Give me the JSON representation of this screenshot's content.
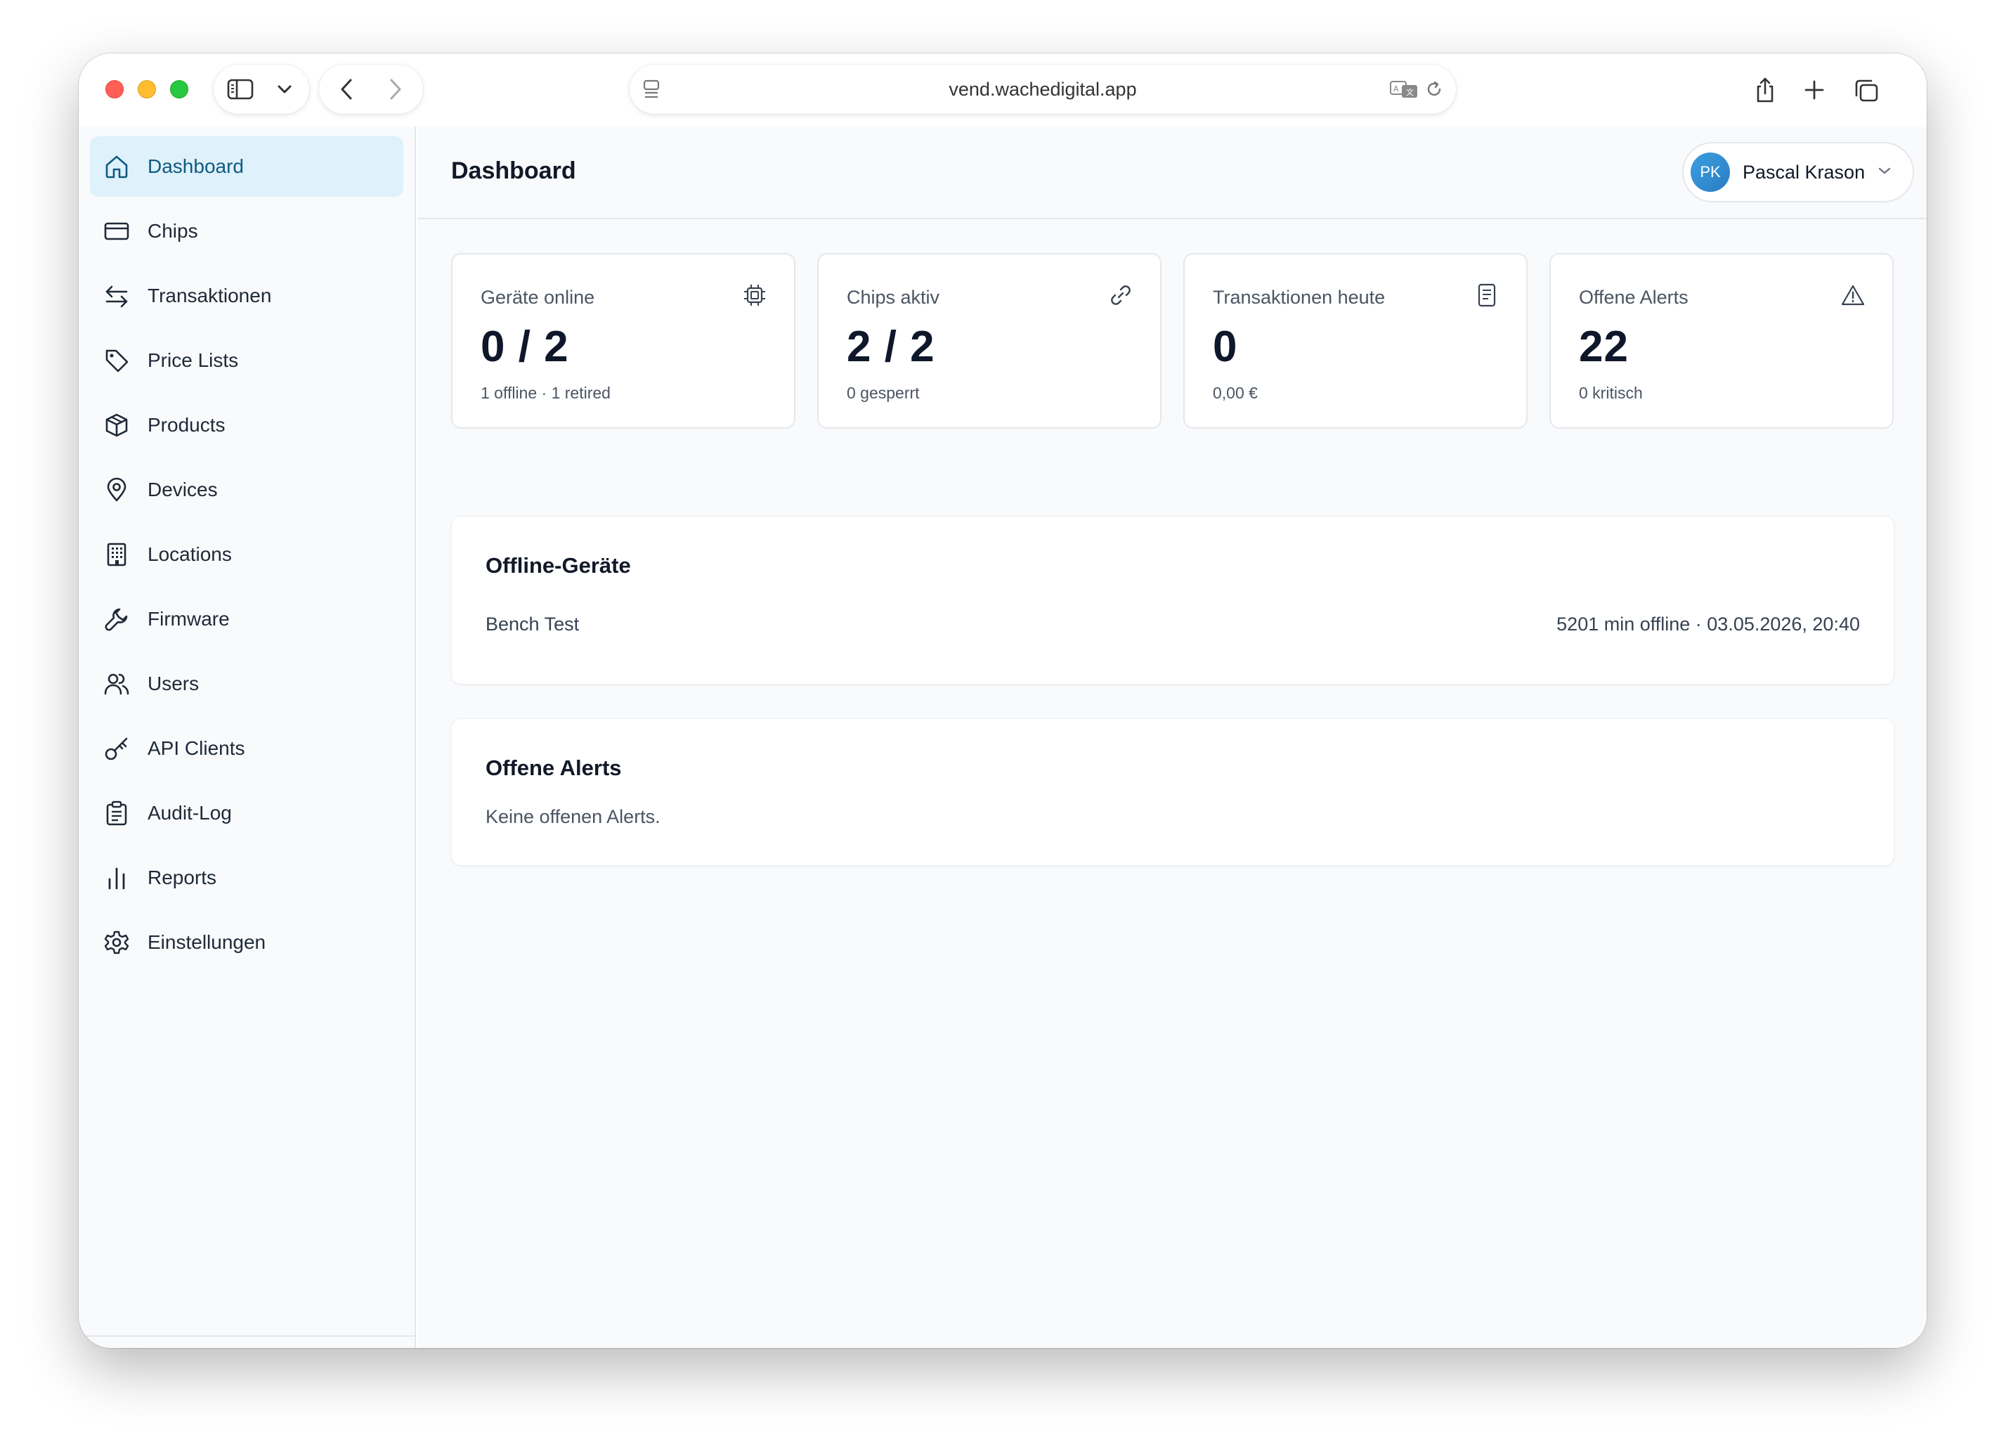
{
  "browser": {
    "url": "vend.wachedigital.app"
  },
  "sidebar": {
    "items": [
      {
        "label": "Dashboard",
        "icon": "home-icon",
        "active": true
      },
      {
        "label": "Chips",
        "icon": "card-icon"
      },
      {
        "label": "Transaktionen",
        "icon": "arrows-swap-icon"
      },
      {
        "label": "Price Lists",
        "icon": "tag-icon"
      },
      {
        "label": "Products",
        "icon": "box-icon"
      },
      {
        "label": "Devices",
        "icon": "map-pin-icon"
      },
      {
        "label": "Locations",
        "icon": "building-icon"
      },
      {
        "label": "Firmware",
        "icon": "wrench-icon"
      },
      {
        "label": "Users",
        "icon": "users-icon"
      },
      {
        "label": "API Clients",
        "icon": "key-icon"
      },
      {
        "label": "Audit-Log",
        "icon": "clipboard-icon"
      },
      {
        "label": "Reports",
        "icon": "bar-chart-icon"
      },
      {
        "label": "Einstellungen",
        "icon": "gear-icon"
      }
    ],
    "collapse_glyph": "«"
  },
  "header": {
    "title": "Dashboard",
    "user": {
      "initials": "PK",
      "name": "Pascal Krason"
    }
  },
  "stats": [
    {
      "label": "Geräte online",
      "value": "0 / 2",
      "sub": "1 offline · 1 retired",
      "icon": "chip-icon"
    },
    {
      "label": "Chips aktiv",
      "value": "2 / 2",
      "sub": "0 gesperrt",
      "icon": "link-icon"
    },
    {
      "label": "Transaktionen heute",
      "value": "0",
      "sub": "0,00 €",
      "icon": "receipt-icon"
    },
    {
      "label": "Offene Alerts",
      "value": "22",
      "sub": "0 kritisch",
      "icon": "warning-icon"
    }
  ],
  "offline_devices": {
    "title": "Offline-Geräte",
    "rows": [
      {
        "name": "Bench Test",
        "status": "5201 min offline · 03.05.2026, 20:40"
      }
    ]
  },
  "open_alerts": {
    "title": "Offene Alerts",
    "empty": "Keine offenen Alerts."
  },
  "colors": {
    "accent_bg": "#dff1fb",
    "accent_text": "#0f5a82",
    "avatar": "#3b9fe0"
  }
}
